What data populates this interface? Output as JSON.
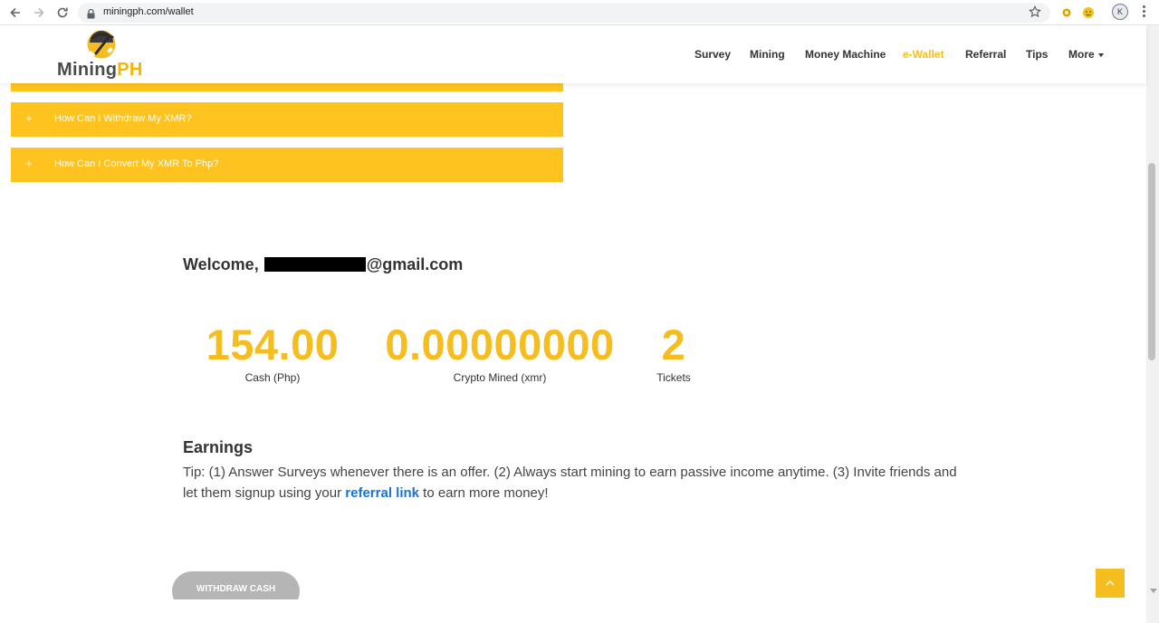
{
  "browser": {
    "url": "miningph.com/wallet",
    "profile_initial": "K"
  },
  "site": {
    "logo_part1": "Mining",
    "logo_part2": "PH",
    "nav": [
      {
        "label": "Survey",
        "active": false
      },
      {
        "label": "Mining",
        "active": false
      },
      {
        "label": "Money Machine",
        "active": false
      },
      {
        "label": "e-Wallet",
        "active": true
      },
      {
        "label": "Referral",
        "active": false
      },
      {
        "label": "Tips",
        "active": false
      },
      {
        "label": "More",
        "active": false
      }
    ]
  },
  "faq": {
    "items": [
      {
        "icon": "+",
        "label": "How Can I Withdraw My XMR?"
      },
      {
        "icon": "+",
        "label": "How Can I Convert My XMR To Php?"
      }
    ]
  },
  "welcome": {
    "prefix": "Welcome,",
    "suffix": "@gmail.com"
  },
  "stats": [
    {
      "value": "154.00",
      "label": "Cash (Php)"
    },
    {
      "value": "0.00000000",
      "label": "Crypto Mined (xmr)"
    },
    {
      "value": "2",
      "label": "Tickets"
    }
  ],
  "earnings": {
    "title": "Earnings",
    "tip_before": "Tip: (1) Answer Surveys whenever there is an offer. (2) Always start mining to earn passive income anytime. (3) Invite friends and let them signup using your ",
    "link_text": "referral link",
    "tip_after": " to earn more money!"
  },
  "withdraw": {
    "label": "WITHDRAW CASH"
  },
  "colors": {
    "accent": "#f5bd1f",
    "faq_bg": "#ffc31f",
    "link": "#1a73d6"
  }
}
